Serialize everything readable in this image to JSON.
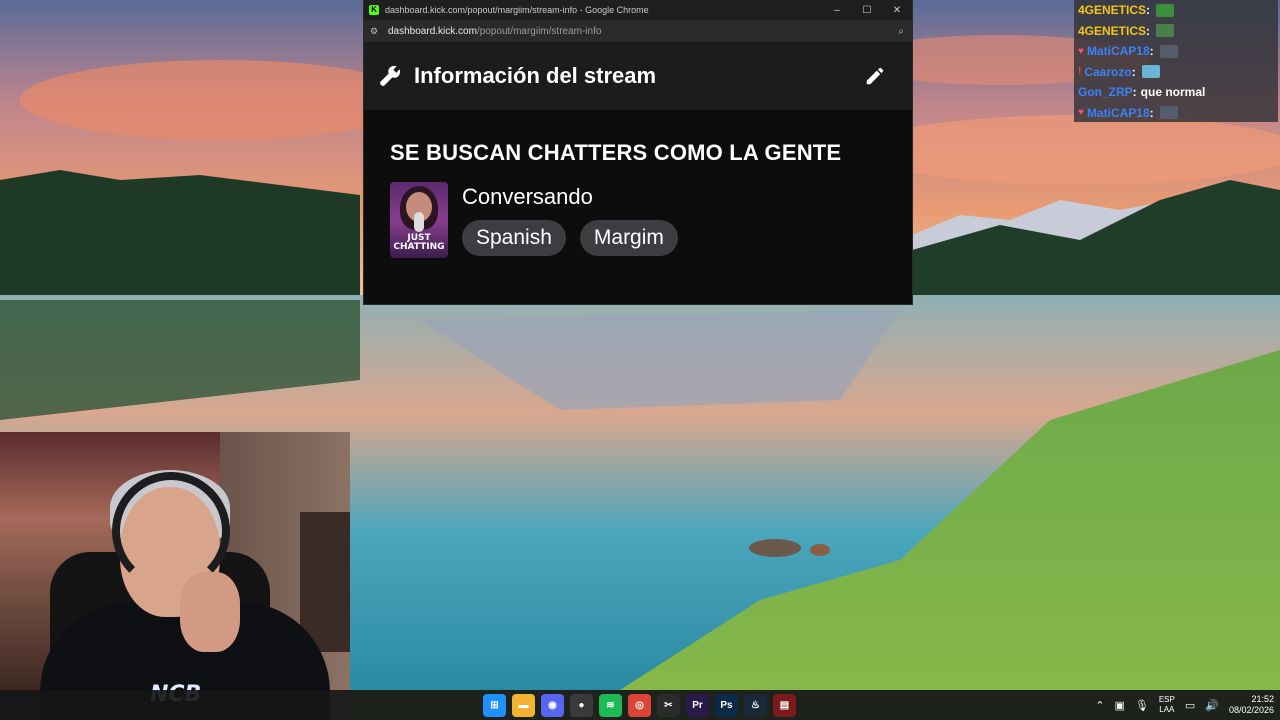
{
  "browser": {
    "window_title": "dashboard.kick.com/popout/margiim/stream-info - Google Chrome",
    "url_host": "dashboard.kick.com",
    "url_path": "/popout/margiim/stream-info",
    "window_buttons": [
      "–",
      "☐",
      "✕"
    ]
  },
  "panel": {
    "heading": "Información del stream",
    "stream_title": "SE BUSCAN CHATTERS COMO LA GENTE",
    "category": "Conversando",
    "category_thumb_label": "JUST CHATTING",
    "tags": [
      "Spanish",
      "Margim"
    ]
  },
  "chat": {
    "messages": [
      {
        "user": "4GENETICS",
        "color": "#f5c518",
        "badge": "",
        "text": "",
        "emote": "#3a8f3a"
      },
      {
        "user": "4GENETICS",
        "color": "#f5c518",
        "badge": "",
        "text": "",
        "emote": "#4a7f4a"
      },
      {
        "user": "MatiCAP18",
        "color": "#3b82f6",
        "badge": "♥",
        "text": "",
        "emote": "#555c6a"
      },
      {
        "user": "Caarozo",
        "color": "#3b82f6",
        "badge": "!",
        "text": "",
        "emote": "#6ab4d6"
      },
      {
        "user": "Gon_ZRP",
        "color": "#3b82f6",
        "badge": "",
        "text": "que normal",
        "emote": ""
      },
      {
        "user": "MatiCAP18",
        "color": "#3b82f6",
        "badge": "♥",
        "text": "",
        "emote": "#555c6a"
      }
    ]
  },
  "webcam": {
    "shirt_logo": "NCB"
  },
  "taskbar": {
    "apps": [
      {
        "name": "windows-start",
        "glyph": "⊞",
        "color": "#1e90ff"
      },
      {
        "name": "file-explorer",
        "glyph": "▬",
        "color": "#f2b233"
      },
      {
        "name": "discord",
        "glyph": "◉",
        "color": "#5865f2"
      },
      {
        "name": "obs",
        "glyph": "●",
        "color": "#3a3a3a"
      },
      {
        "name": "spotify",
        "glyph": "≋",
        "color": "#1db954"
      },
      {
        "name": "chrome",
        "glyph": "◎",
        "color": "#db4437"
      },
      {
        "name": "capcut",
        "glyph": "✂",
        "color": "#2b2b2b"
      },
      {
        "name": "premiere",
        "glyph": "Pr",
        "color": "#2a1a4a"
      },
      {
        "name": "photoshop",
        "glyph": "Ps",
        "color": "#0b2a4a"
      },
      {
        "name": "steam",
        "glyph": "♨",
        "color": "#1b2838"
      },
      {
        "name": "media-app",
        "glyph": "▤",
        "color": "#7a1a1a"
      }
    ],
    "lang_top": "ESP",
    "lang_bottom": "LAA",
    "time": "21:52",
    "date": "08/02/2026"
  }
}
